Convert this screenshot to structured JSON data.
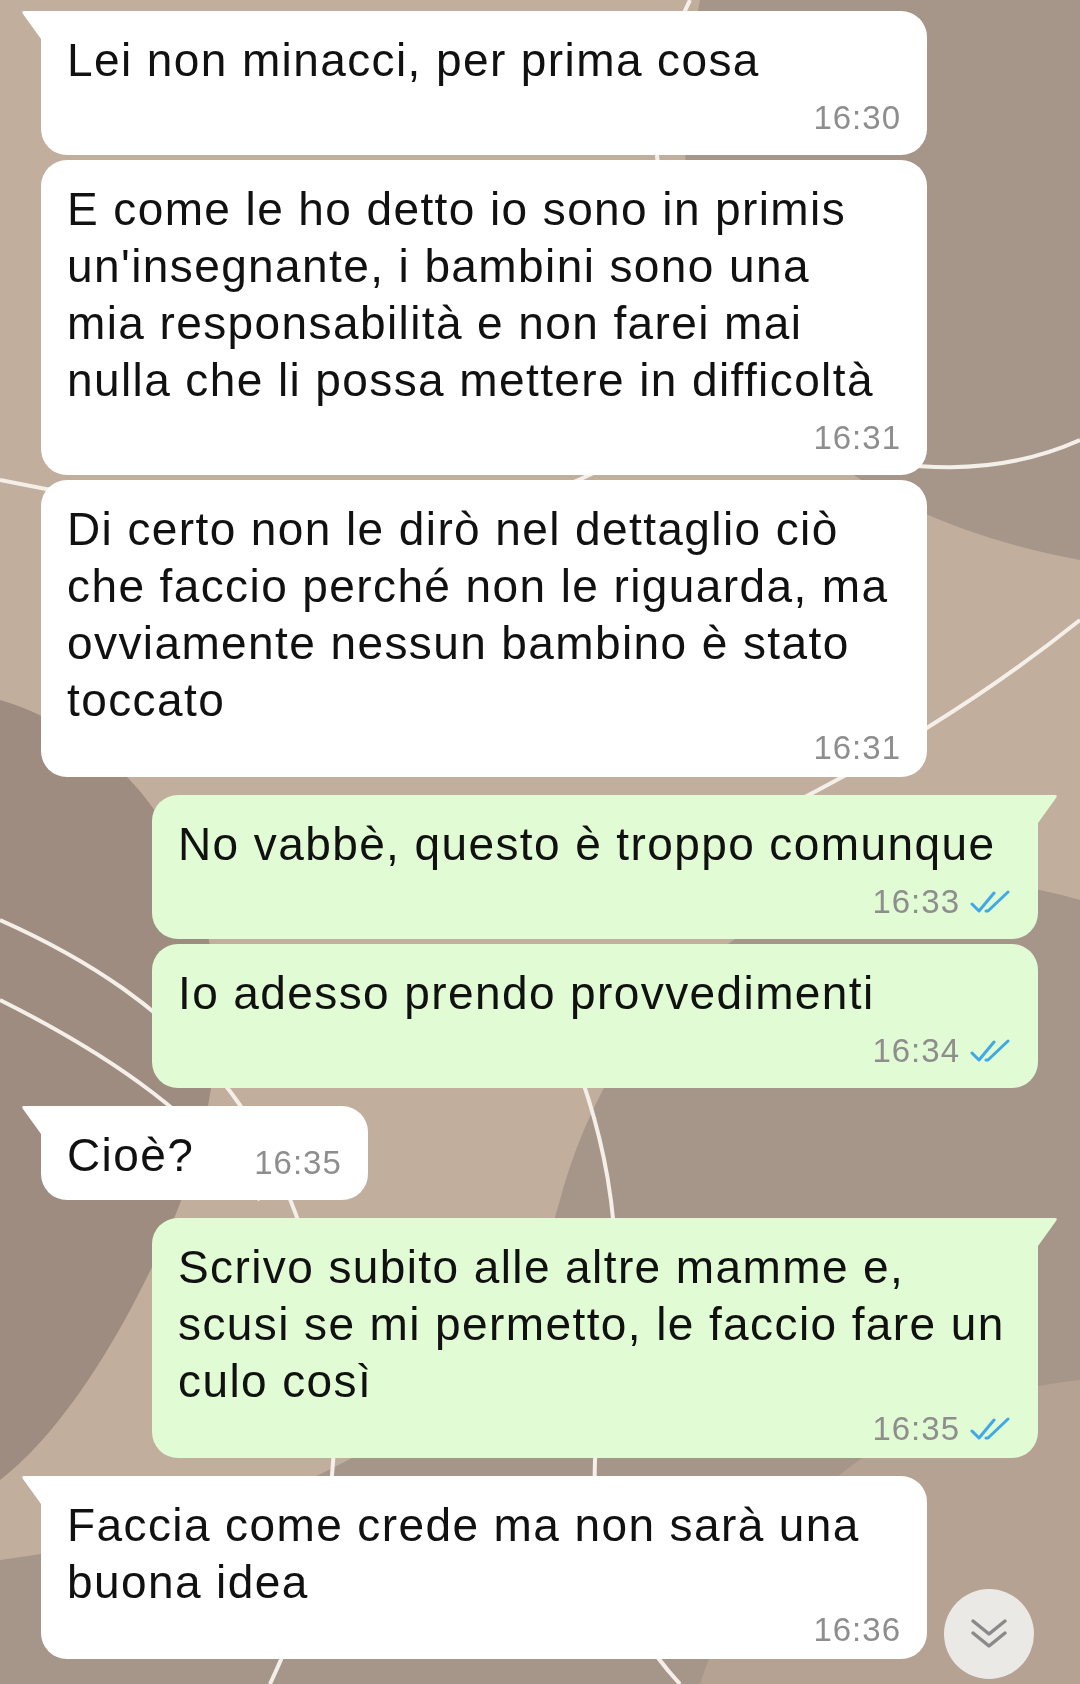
{
  "messages": [
    {
      "kind": "incoming",
      "text": "Lei non minacci, per prima cosa",
      "time": "16:30"
    },
    {
      "kind": "incoming",
      "text": "E come le ho detto io sono in primis un'insegnante, i bambini sono una mia responsabilità e non farei mai nulla che li possa mettere in difficoltà",
      "time": "16:31"
    },
    {
      "kind": "incoming",
      "text": "Di certo non le dirò nel dettaglio ciò che faccio perché non le riguarda, ma ovviamente nessun bambino è stato toccato",
      "time": "16:31"
    },
    {
      "kind": "outgoing",
      "text": "No vabbè, questo è troppo comunque",
      "time": "16:33",
      "read": true
    },
    {
      "kind": "outgoing",
      "text": "Io adesso prendo provvedimenti",
      "time": "16:34",
      "read": true
    },
    {
      "kind": "incoming",
      "text": "Cioè?",
      "time": "16:35"
    },
    {
      "kind": "outgoing",
      "text": "Scrivo subito alle altre mamme e, scusi se mi permetto, le faccio fare un culo così",
      "time": "16:35",
      "read": true
    },
    {
      "kind": "incoming",
      "text": "Faccia come crede ma non sarà una buona idea",
      "time": "16:36"
    }
  ],
  "scroll_to_bottom_button": true
}
